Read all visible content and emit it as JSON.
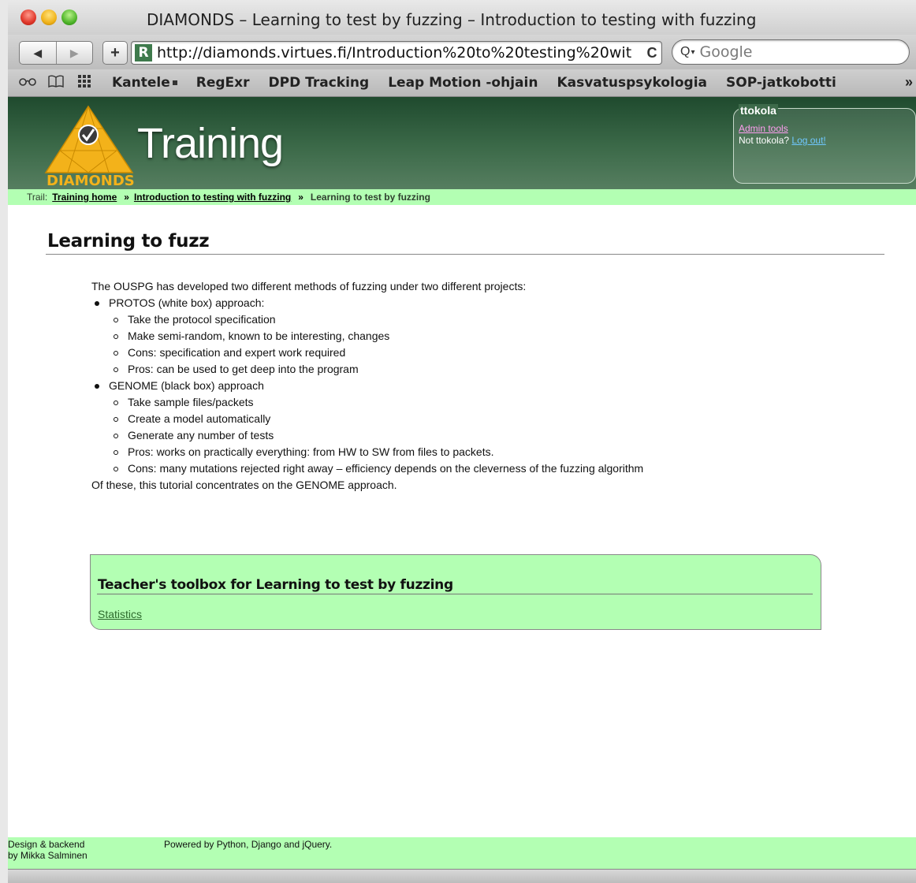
{
  "window": {
    "title": "DIAMONDS – Learning to test by fuzzing – Introduction to testing with fuzzing"
  },
  "toolbar": {
    "back_icon": "◀",
    "forward_icon": "▶",
    "add_icon": "+",
    "favicon_letter": "R",
    "url": "http://diamonds.virtues.fi/Introduction%20to%20testing%20wit",
    "reload_icon": "C",
    "search_icon": "Q",
    "search_caret": "▾",
    "search_placeholder": "Google"
  },
  "bookmarks": {
    "icons": [
      "reading-glasses-icon",
      "book-icon",
      "grid-icon"
    ],
    "items": [
      "Kantele",
      "RegExr",
      "DPD Tracking",
      "Leap Motion -ohjain",
      "Kasvatuspsykologia",
      "SOP-jatkobotti"
    ],
    "more": "»"
  },
  "header": {
    "logo_text": "DIAMONDS",
    "site_title": "Training",
    "brand_color": "#f3b21a"
  },
  "user": {
    "name": "ttokola",
    "admin_link": "Admin tools",
    "not_user": "Not ttokola?",
    "logout": "Log out!"
  },
  "trail": {
    "label": "Trail:",
    "links": [
      "Training home",
      "Introduction to testing with fuzzing"
    ],
    "separator": "»",
    "current": "Learning to test by fuzzing"
  },
  "main": {
    "title": "Learning to fuzz",
    "intro": "The OUSPG has developed two different methods of fuzzing under two different projects:",
    "methods": [
      {
        "label": "PROTOS (white box) approach:",
        "points": [
          "Take the protocol specification",
          "Make semi-random, known to be interesting, changes",
          "Cons: specification and expert work required",
          "Pros: can be used to get deep into the program"
        ]
      },
      {
        "label": "GENOME (black box) approach",
        "points": [
          "Take sample files/packets",
          "Create a model automatically",
          "Generate any number of tests",
          "Pros: works on practically everything: from HW to SW from files to packets.",
          "Cons: many mutations rejected right away – efficiency depends on the cleverness of the fuzzing algorithm"
        ]
      }
    ],
    "outro": "Of these, this tutorial concentrates on the GENOME approach."
  },
  "toolbox": {
    "title": "Teacher's toolbox for Learning to test by fuzzing",
    "link": "Statistics"
  },
  "footer": {
    "credit_line1": "Design & backend",
    "credit_line2": "by Mikka Salminen",
    "powered": "Powered by Python, Django and jQuery."
  }
}
